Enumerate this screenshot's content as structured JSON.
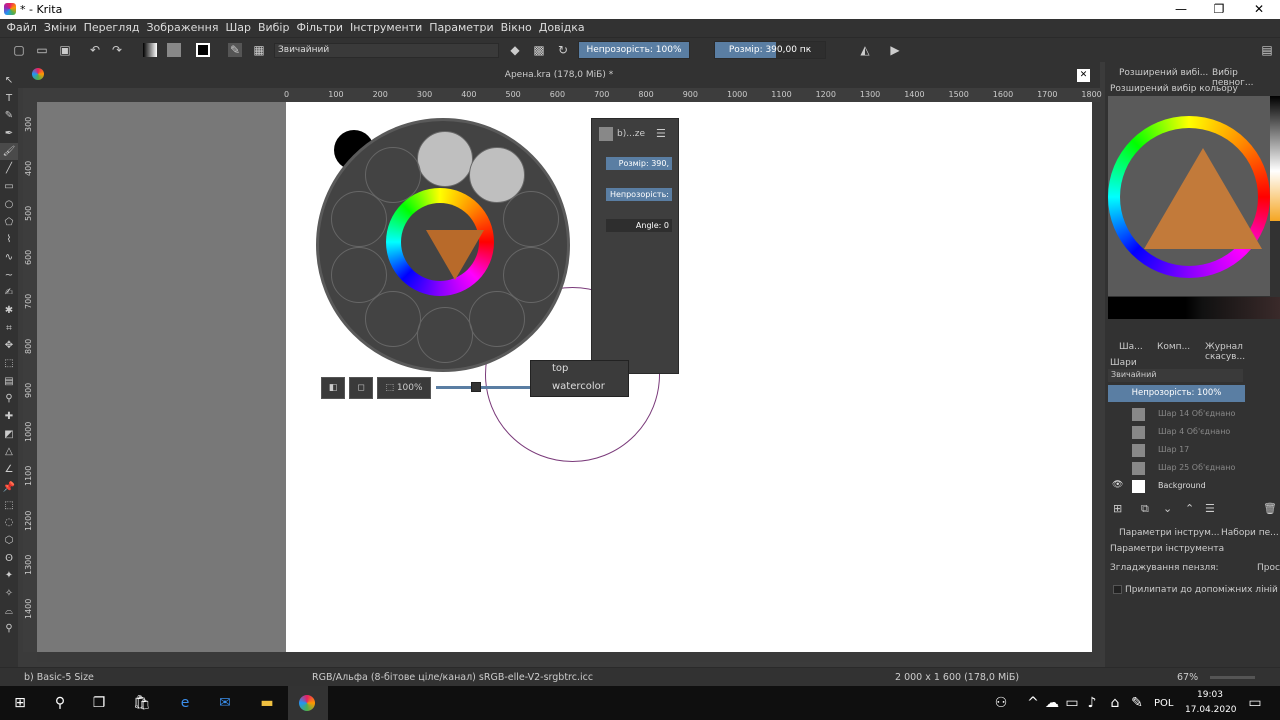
{
  "window": {
    "title": "* - Krita",
    "minimize": "—",
    "maximize": "❐",
    "close": "✕"
  },
  "menu": [
    "Файл",
    "Зміни",
    "Перегляд",
    "Зображення",
    "Шар",
    "Вибір",
    "Фільтри",
    "Інструменти",
    "Параметри",
    "Вікно",
    "Довідка"
  ],
  "toolbar": {
    "blend_mode": "Звичайний",
    "opacity_label": "Непрозорість: 100%",
    "opacity_value": 100,
    "size_label": "Розмір: 390,00 пк",
    "size_fraction": 0.55
  },
  "document": {
    "title": "Арена.kra (178,0 МіБ) *",
    "close": "✕"
  },
  "ruler_top": [
    "0",
    "100",
    "200",
    "300",
    "400",
    "500",
    "600",
    "700",
    "800",
    "900",
    "1000",
    "1100",
    "1200",
    "1300",
    "1400",
    "1500",
    "1600",
    "1700",
    "1800"
  ],
  "ruler_left": [
    "300",
    "400",
    "500",
    "600",
    "700",
    "800",
    "900",
    "1000",
    "1100",
    "1200",
    "1300",
    "1400"
  ],
  "brush_panel": {
    "name": "b)...ze",
    "size": "Розмір: 390,",
    "opacity": "Непрозорість:",
    "angle": "Angle: 0"
  },
  "tag_menu": [
    "top",
    "watercolor"
  ],
  "palette_buttons": {
    "zoom": "100%"
  },
  "dock": {
    "tab1": "Розширений вибі...",
    "tab2": "Вибір певног...",
    "advanced_color": "Розширений вибір кольору",
    "layers_tab": "Ша...",
    "comp_tab": "Комп...",
    "history_tab": "Журнал скасув...",
    "layers_title": "Шари",
    "layers_blend": "Звичайний",
    "layers_opacity": "Непрозорість:  100%",
    "layers": [
      "Шар 14 Об'єднано",
      "Шар 4 Об'єднано",
      "Шар 17",
      "Шар 25 Об'єднано",
      "Background"
    ],
    "tool_opts_tab": "Параметри інструм...",
    "brush_sets_tab": "Набори пе...",
    "tool_opts_title": "Параметри інструмента",
    "smoothing_label": "Згладжування пензля:",
    "smoothing_value": "Прост",
    "snap_label": "Прилипати до допоміжних ліній"
  },
  "status": {
    "brush": "b) Basic-5 Size",
    "colorspace": "RGB/Альфа (8-бітове ціле/канал)  sRGB-elle-V2-srgbtrc.icc",
    "dimensions": "2 000 x 1 600 (178,0 МіБ)",
    "zoom": "67%"
  },
  "taskbar": {
    "language": "POL",
    "time": "19:03",
    "date": "17.04.2020"
  },
  "colors": {
    "accent": "#5a7ea3",
    "fg_color": "#000000",
    "brush_color": "#b86a2a"
  }
}
